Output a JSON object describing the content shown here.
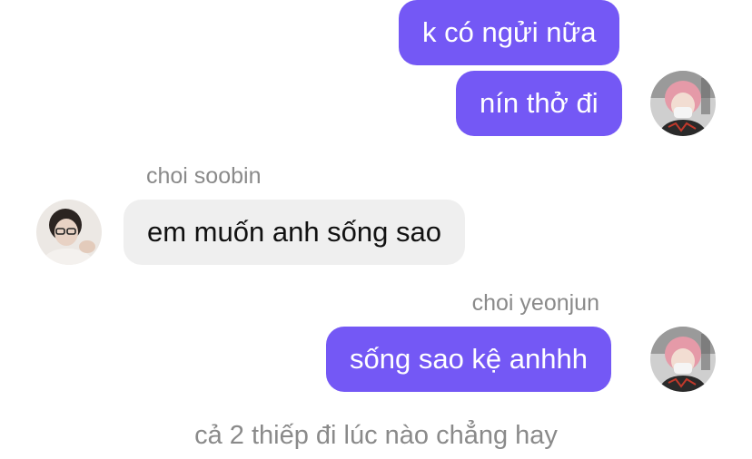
{
  "messages": [
    {
      "text": "k có ngửi nữa"
    },
    {
      "text": "nín thở đi"
    },
    {
      "sender": "choi soobin",
      "text": "em muốn anh sống sao"
    },
    {
      "sender": "choi yeonjun",
      "text": "sống sao kệ anhhh"
    }
  ],
  "footer_message": "cả 2 thiếp đi lúc nào chẳng hay",
  "colors": {
    "outgoing_bubble": "#7458f5",
    "incoming_bubble": "#efefef",
    "meta_text": "#8a8a8a"
  },
  "avatars": {
    "yeonjun": "avatar-yeonjun-icon",
    "soobin": "avatar-soobin-icon"
  }
}
